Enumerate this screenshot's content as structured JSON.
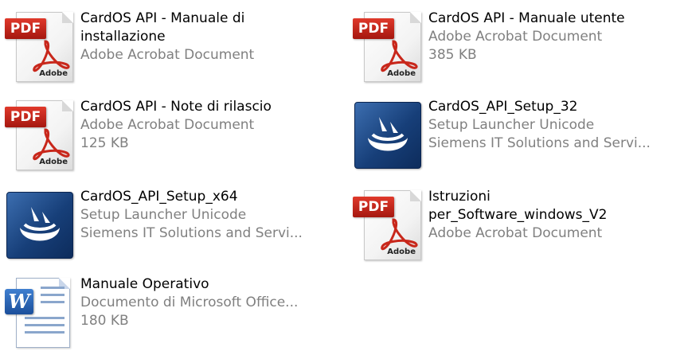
{
  "files": [
    {
      "name_lines": [
        "CardOS API - Manuale di",
        "installazione"
      ],
      "type": "Adobe Acrobat Document",
      "detail": "",
      "icon": "pdf-icon"
    },
    {
      "name_lines": [
        "CardOS API - Manuale utente"
      ],
      "type": "Adobe Acrobat Document",
      "detail": "385 KB",
      "icon": "pdf-icon"
    },
    {
      "name_lines": [
        "CardOS API - Note di rilascio"
      ],
      "type": "Adobe Acrobat Document",
      "detail": "125 KB",
      "icon": "pdf-icon"
    },
    {
      "name_lines": [
        "CardOS_API_Setup_32"
      ],
      "type": "Setup Launcher Unicode",
      "detail": "Siemens IT Solutions and Servi...",
      "icon": "setup-launcher-icon"
    },
    {
      "name_lines": [
        "CardOS_API_Setup_x64"
      ],
      "type": "Setup Launcher Unicode",
      "detail": "Siemens IT Solutions and Servi...",
      "icon": "setup-launcher-icon"
    },
    {
      "name_lines": [
        "Istruzioni",
        "per_Software_windows_V2"
      ],
      "type": "Adobe Acrobat Document",
      "detail": "",
      "icon": "pdf-icon"
    },
    {
      "name_lines": [
        "Manuale Operativo"
      ],
      "type": "Documento di Microsoft Office...",
      "detail": "180 KB",
      "icon": "word-document-icon"
    }
  ],
  "icon_text": {
    "pdf_tag": "PDF",
    "pdf_brand": "Adobe",
    "word_letter": "W"
  },
  "colors": {
    "name_text": "#000000",
    "meta_text": "#808080",
    "pdf_red": "#c8271b",
    "setup_blue": "#173f79",
    "word_blue": "#2b62b3"
  }
}
